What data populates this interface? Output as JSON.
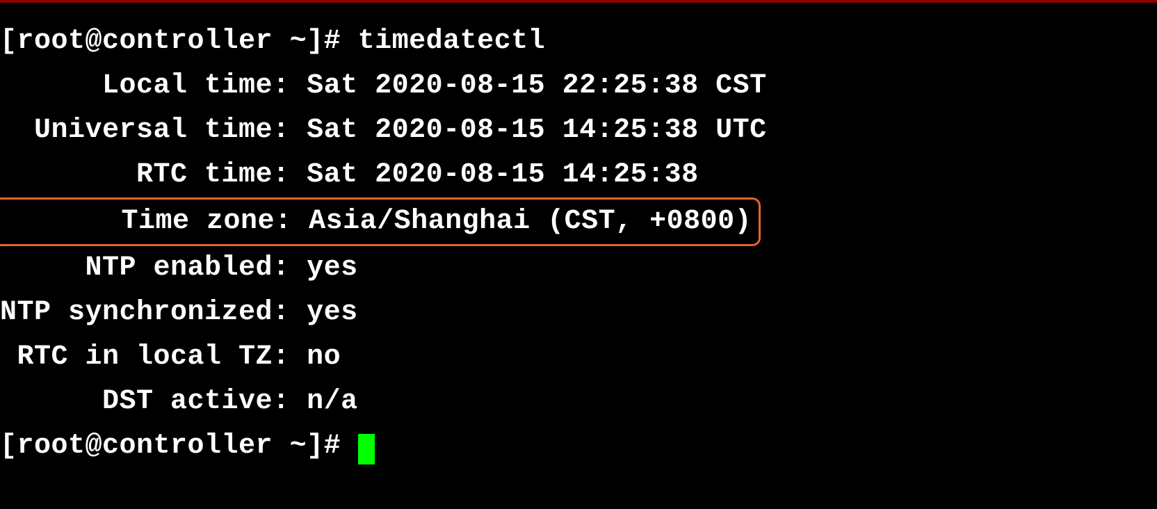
{
  "terminal": {
    "prompt1": "[root@controller ~]# ",
    "command": "timedatectl",
    "output": {
      "local_time_label": "      Local time: ",
      "local_time_value": "Sat 2020-08-15 22:25:38 CST",
      "universal_time_label": "  Universal time: ",
      "universal_time_value": "Sat 2020-08-15 14:25:38 UTC",
      "rtc_time_label": "        RTC time: ",
      "rtc_time_value": "Sat 2020-08-15 14:25:38",
      "time_zone_label": "       Time zone: ",
      "time_zone_value": "Asia/Shanghai (CST, +0800)",
      "ntp_enabled_label": "     NTP enabled: ",
      "ntp_enabled_value": "yes",
      "ntp_sync_label": "NTP synchronized: ",
      "ntp_sync_value": "yes",
      "rtc_local_label": " RTC in local TZ: ",
      "rtc_local_value": "no",
      "dst_active_label": "      DST active: ",
      "dst_active_value": "n/a"
    },
    "prompt2": "[root@controller ~]# "
  }
}
